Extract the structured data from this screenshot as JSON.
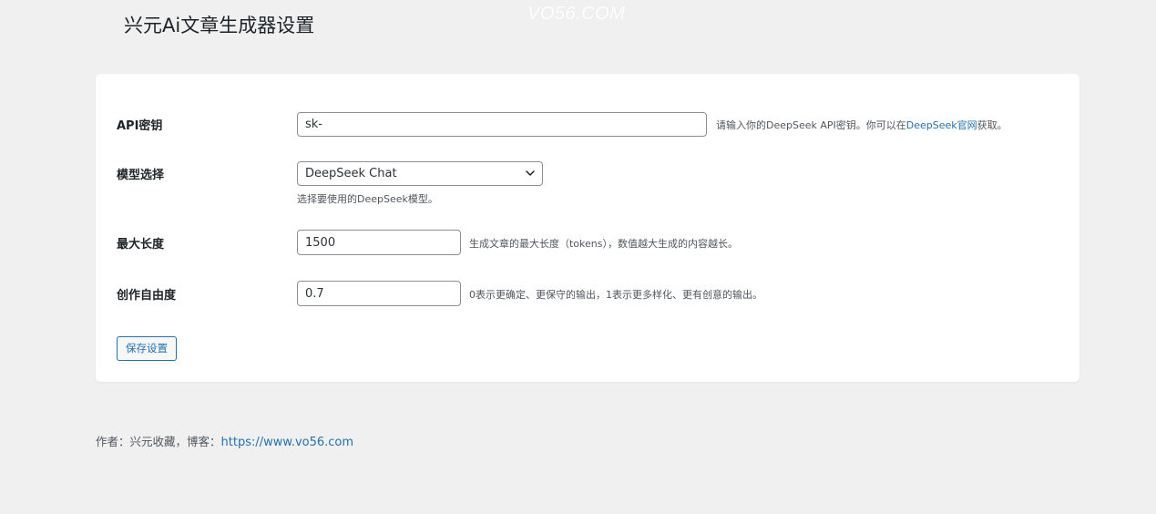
{
  "watermark": "VO56.COM",
  "page_title": "兴元Ai文章生成器设置",
  "api_key": {
    "label": "API密钥",
    "value": "sk-",
    "desc_prefix": "请输入你的DeepSeek API密钥。你可以在",
    "desc_link": "DeepSeek官网",
    "desc_suffix": "获取。"
  },
  "model": {
    "label": "模型选择",
    "selected": "DeepSeek Chat",
    "desc": "选择要使用的DeepSeek模型。",
    "chevron_icon": "chevron-down-icon"
  },
  "max_length": {
    "label": "最大长度",
    "value": "1500",
    "desc": "生成文章的最大长度（tokens），数值越大生成的内容越长。"
  },
  "creativity": {
    "label": "创作自由度",
    "value": "0.7",
    "desc": "0表示更确定、更保守的输出，1表示更多样化、更有创意的输出。"
  },
  "save_button": "保存设置",
  "footer": {
    "text": "作者：兴元收藏，博客：",
    "link": "https://www.vo56.com"
  },
  "colors": {
    "background": "#f0f0f1",
    "card": "#ffffff",
    "link": "#2271b1",
    "border": "#8c8f94"
  }
}
